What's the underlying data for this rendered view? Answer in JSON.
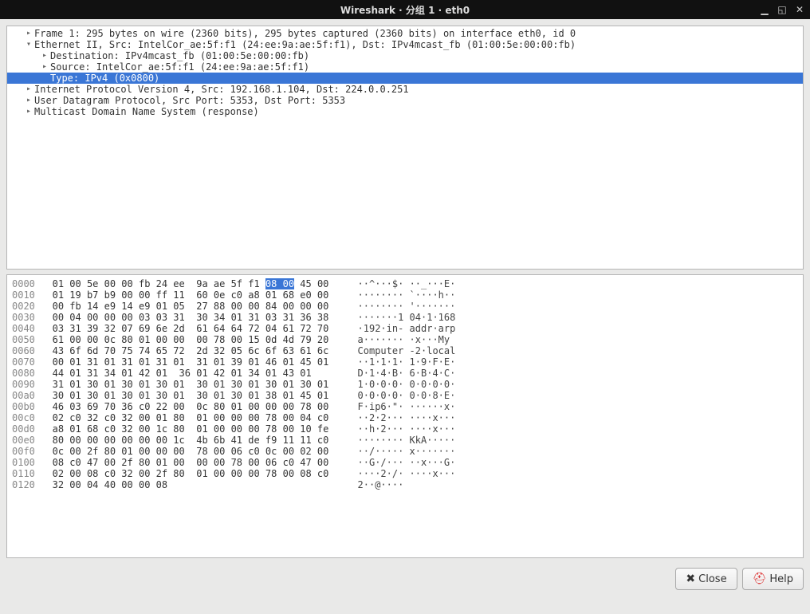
{
  "window": {
    "title": "Wireshark · 分组 1 · eth0"
  },
  "tree": {
    "rows": [
      {
        "level": 0,
        "expanded": false,
        "selected": false,
        "text": "Frame 1: 295 bytes on wire (2360 bits), 295 bytes captured (2360 bits) on interface eth0, id 0"
      },
      {
        "level": 0,
        "expanded": true,
        "selected": false,
        "text": "Ethernet II, Src: IntelCor_ae:5f:f1 (24:ee:9a:ae:5f:f1), Dst: IPv4mcast_fb (01:00:5e:00:00:fb)"
      },
      {
        "level": 1,
        "expanded": false,
        "selected": false,
        "text": "Destination: IPv4mcast_fb (01:00:5e:00:00:fb)"
      },
      {
        "level": 1,
        "expanded": false,
        "selected": false,
        "text": "Source: IntelCor_ae:5f:f1 (24:ee:9a:ae:5f:f1)"
      },
      {
        "level": 1,
        "expanded": null,
        "selected": true,
        "text": "Type: IPv4 (0x0800)"
      },
      {
        "level": 0,
        "expanded": false,
        "selected": false,
        "text": "Internet Protocol Version 4, Src: 192.168.1.104, Dst: 224.0.0.251"
      },
      {
        "level": 0,
        "expanded": false,
        "selected": false,
        "text": "User Datagram Protocol, Src Port: 5353, Dst Port: 5353"
      },
      {
        "level": 0,
        "expanded": false,
        "selected": false,
        "text": "Multicast Domain Name System (response)"
      }
    ]
  },
  "hex": {
    "rows": [
      {
        "off": "0000",
        "a": "01 00 5e 00 00 fb 24 ee",
        "b": "9a ae 5f f1 ",
        "hl": "08 00",
        "c": " 45 00",
        "ascii": "··^···$· ··_···E·"
      },
      {
        "off": "0010",
        "a": "01 19 b7 b9 00 00 ff 11",
        "b": "60 0e c0 a8 01 68 e0 00",
        "ascii": "········ `····h··"
      },
      {
        "off": "0020",
        "a": "00 fb 14 e9 14 e9 01 05",
        "b": "27 88 00 00 84 00 00 00",
        "ascii": "········ '·······"
      },
      {
        "off": "0030",
        "a": "00 04 00 00 00 03 03 31",
        "b": "30 34 01 31 03 31 36 38",
        "ascii": "·······1 04·1·168"
      },
      {
        "off": "0040",
        "a": "03 31 39 32 07 69 6e 2d",
        "b": "61 64 64 72 04 61 72 70",
        "ascii": "·192·in- addr·arp"
      },
      {
        "off": "0050",
        "a": "61 00 00 0c 80 01 00 00",
        "b": "00 78 00 15 0d 4d 79 20",
        "ascii": "a······· ·x···My "
      },
      {
        "off": "0060",
        "a": "43 6f 6d 70 75 74 65 72",
        "b": "2d 32 05 6c 6f 63 61 6c",
        "ascii": "Computer -2·local"
      },
      {
        "off": "0070",
        "a": "00 01 31 01 31 01 31 01",
        "b": "31 01 39 01 46 01 45 01",
        "ascii": "··1·1·1· 1·9·F·E·"
      },
      {
        "off": "0080",
        "a": "44 01 31 34 01 42 01",
        "b": "36 01 42 01 34 01 43 01",
        "ascii": "D·1·4·B· 6·B·4·C·"
      },
      {
        "off": "0090",
        "a": "31 01 30 01 30 01 30 01",
        "b": "30 01 30 01 30 01 30 01",
        "ascii": "1·0·0·0· 0·0·0·0·"
      },
      {
        "off": "00a0",
        "a": "30 01 30 01 30 01 30 01",
        "b": "30 01 30 01 38 01 45 01",
        "ascii": "0·0·0·0· 0·0·8·E·"
      },
      {
        "off": "00b0",
        "a": "46 03 69 70 36 c0 22 00",
        "b": "0c 80 01 00 00 00 78 00",
        "ascii": "F·ip6·\"· ······x·"
      },
      {
        "off": "00c0",
        "a": "02 c0 32 c0 32 00 01 80",
        "b": "01 00 00 00 78 00 04 c0",
        "ascii": "··2·2··· ····x···"
      },
      {
        "off": "00d0",
        "a": "a8 01 68 c0 32 00 1c 80",
        "b": "01 00 00 00 78 00 10 fe",
        "ascii": "··h·2··· ····x···"
      },
      {
        "off": "00e0",
        "a": "80 00 00 00 00 00 00 1c",
        "b": "4b 6b 41 de f9 11 11 c0",
        "ascii": "········ KkA·····"
      },
      {
        "off": "00f0",
        "a": "0c 00 2f 80 01 00 00 00",
        "b": "78 00 06 c0 0c 00 02 00",
        "ascii": "··/····· x·······"
      },
      {
        "off": "0100",
        "a": "08 c0 47 00 2f 80 01 00",
        "b": "00 00 78 00 06 c0 47 00",
        "ascii": "··G·/··· ··x···G·"
      },
      {
        "off": "0110",
        "a": "02 00 08 c0 32 00 2f 80",
        "b": "01 00 00 00 78 00 08 c0",
        "ascii": "····2·/· ····x···"
      },
      {
        "off": "0120",
        "a": "32 00 04 40 00 00 08",
        "b": "",
        "ascii": "2··@····"
      }
    ]
  },
  "buttons": {
    "close": "Close",
    "help": "Help"
  }
}
